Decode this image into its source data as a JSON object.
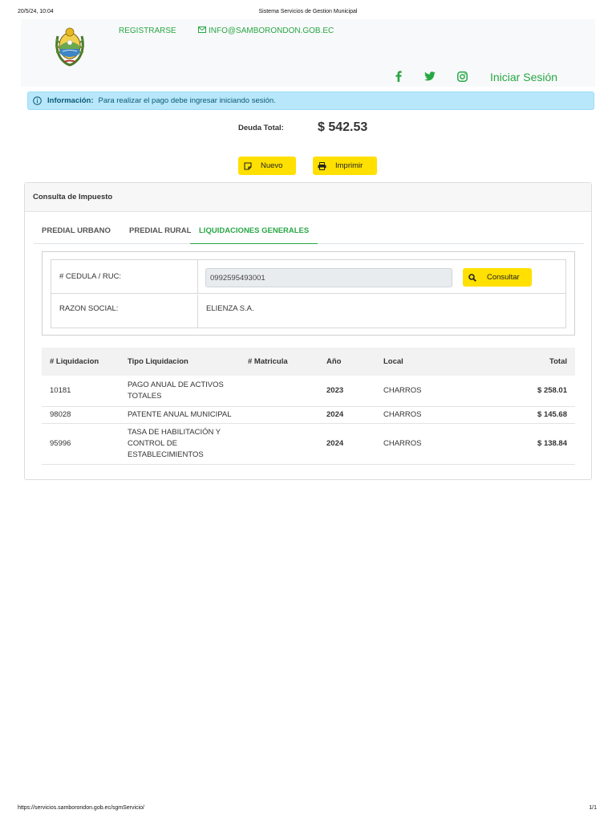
{
  "print": {
    "datetime": "20/5/24, 10:04",
    "title": "Sistema Servicios de Gestion Municipal",
    "url": "https://servicios.samborondon.gob.ec/sgmServicio/",
    "pages": "1/1"
  },
  "header": {
    "register_label": "REGISTRARSE",
    "email_label": "INFO@SAMBORONDON.GOB.EC",
    "login_label": "Iniciar Sesión",
    "social": [
      "facebook-icon",
      "twitter-icon",
      "instagram-icon"
    ],
    "accent_color": "#28a745"
  },
  "alert": {
    "title": "Información:",
    "message": "Para realizar el pago debe ingresar iniciando sesión."
  },
  "debt": {
    "label": "Deuda Total:",
    "value": "$ 542.53"
  },
  "actions": {
    "new_label": "Nuevo",
    "print_label": "Imprimir"
  },
  "card": {
    "title": "Consulta de Impuesto",
    "tabs": [
      {
        "label": "PREDIAL URBANO",
        "active": false
      },
      {
        "label": "PREDIAL RURAL",
        "active": false
      },
      {
        "label": "LIQUIDACIONES GENERALES",
        "active": true
      }
    ]
  },
  "form": {
    "id_label": "# CEDULA / RUC:",
    "id_value": "0992595493001",
    "consult_label": "Consultar",
    "name_label": "RAZON SOCIAL:",
    "name_value": "ELIENZA S.A."
  },
  "table": {
    "headers": [
      "# Liquidacion",
      "Tipo Liquidacion",
      "# Matricula",
      "Año",
      "Local",
      "Total"
    ],
    "rows": [
      {
        "liquidacion": "10181",
        "tipo": "PAGO ANUAL DE ACTIVOS TOTALES",
        "matricula": "",
        "anio": "2023",
        "local": "CHARROS",
        "total": "$ 258.01"
      },
      {
        "liquidacion": "98028",
        "tipo": "PATENTE ANUAL MUNICIPAL",
        "matricula": "",
        "anio": "2024",
        "local": "CHARROS",
        "total": "$ 145.68"
      },
      {
        "liquidacion": "95996",
        "tipo": "TASA DE HABILITACIÓN Y CONTROL DE ESTABLECIMIENTOS",
        "matricula": "",
        "anio": "2024",
        "local": "CHARROS",
        "total": "$ 138.84"
      }
    ]
  }
}
